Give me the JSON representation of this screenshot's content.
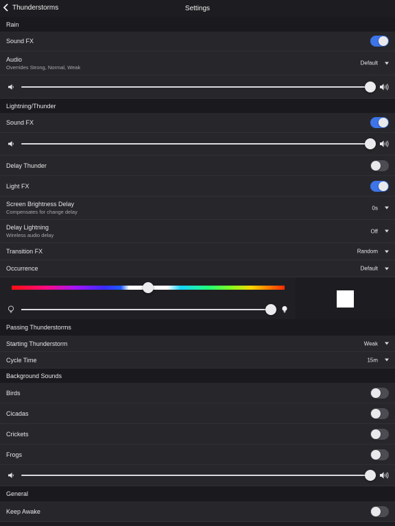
{
  "nav": {
    "back_label": "Thunderstorms",
    "title": "Settings"
  },
  "rain": {
    "header": "Rain",
    "sound_fx": {
      "label": "Sound FX",
      "on": true
    },
    "audio": {
      "label": "Audio",
      "sub": "Overrides Strong, Normal, Weak",
      "value": "Default"
    },
    "volume": 1.0
  },
  "lightning": {
    "header": "Lightning/Thunder",
    "sound_fx": {
      "label": "Sound FX",
      "on": true
    },
    "volume": 1.0,
    "delay_thunder": {
      "label": "Delay Thunder",
      "on": false
    },
    "light_fx": {
      "label": "Light FX",
      "on": true
    },
    "brightness_delay": {
      "label": "Screen Brightness Delay",
      "sub": "Compensates for change delay",
      "value": "0s"
    },
    "delay_lightning": {
      "label": "Delay Lightning",
      "sub": "Wireless audio delay",
      "value": "Off"
    },
    "transition_fx": {
      "label": "Transition FX",
      "value": "Random"
    },
    "occurrence": {
      "label": "Occurrence",
      "value": "Default"
    },
    "hue_position": 0.5,
    "brightness": 0.96,
    "color_swatch": "#ffffff"
  },
  "passing": {
    "header": "Passing Thunderstorms",
    "starting": {
      "label": "Starting Thunderstorm",
      "value": "Weak"
    },
    "cycle": {
      "label": "Cycle Time",
      "value": "15m"
    }
  },
  "background": {
    "header": "Background Sounds",
    "birds": {
      "label": "Birds",
      "on": false
    },
    "cicadas": {
      "label": "Cicadas",
      "on": false
    },
    "crickets": {
      "label": "Crickets",
      "on": false
    },
    "frogs": {
      "label": "Frogs",
      "on": false
    },
    "volume": 1.0
  },
  "general": {
    "header": "General",
    "keep_awake": {
      "label": "Keep Awake",
      "on": false
    }
  },
  "colors": {
    "accent": "#3d74e8",
    "background": "#1d1d21",
    "row": "#27272b"
  },
  "icons": {
    "back": "chevron-left-icon",
    "vol_low": "speaker-low-icon",
    "vol_high": "speaker-high-icon",
    "bulb_off": "bulb-off-icon",
    "bulb_on": "bulb-on-icon"
  }
}
